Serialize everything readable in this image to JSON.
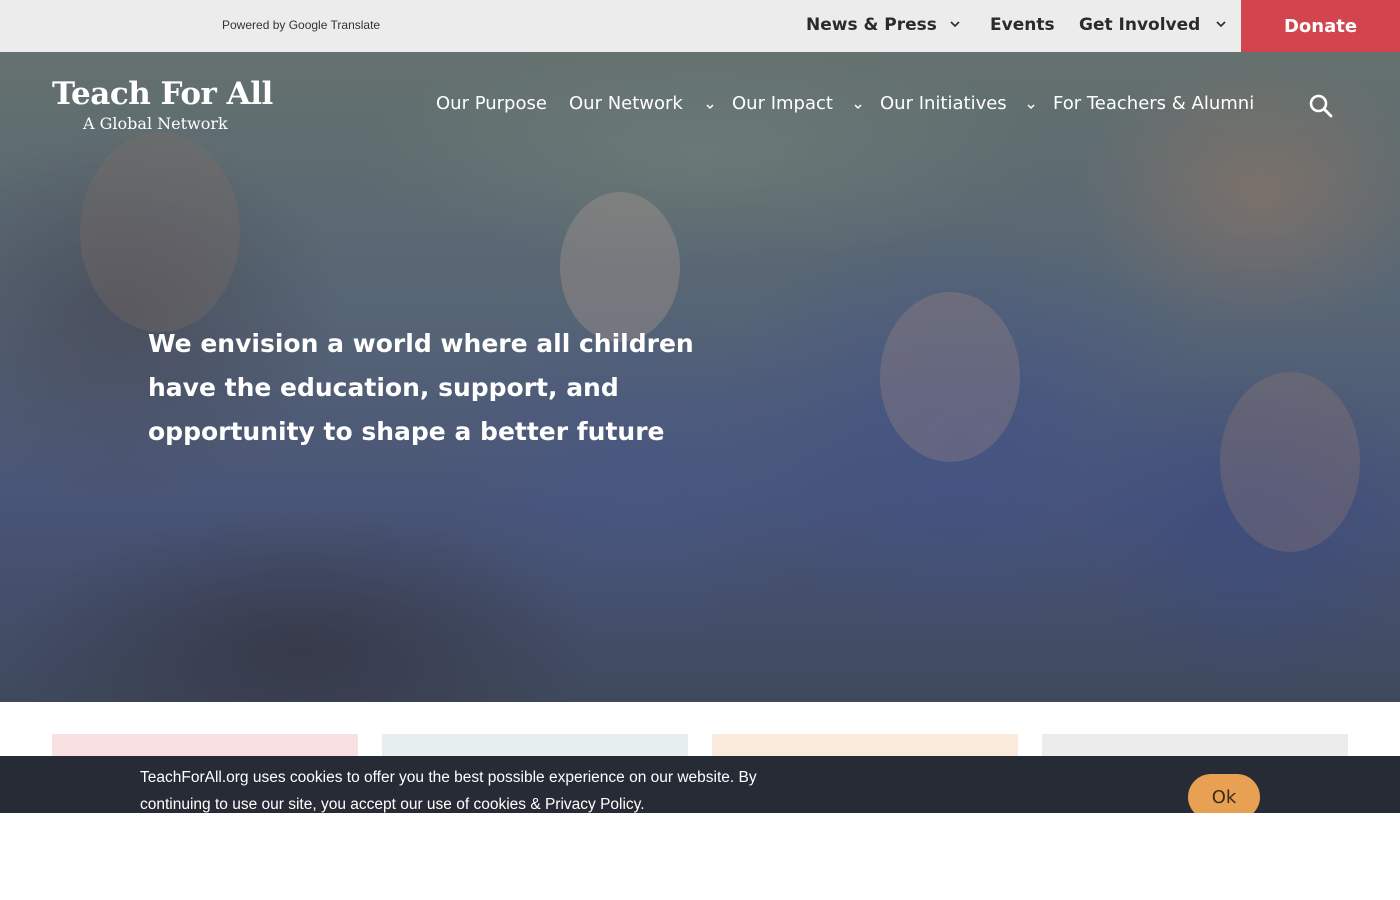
{
  "topbar": {
    "powered_by": "Powered by Google Translate",
    "items": [
      {
        "label": "News & Press",
        "has_dropdown": true
      },
      {
        "label": "Events",
        "has_dropdown": false
      },
      {
        "label": "Get Involved",
        "has_dropdown": true
      }
    ],
    "donate_label": "Donate",
    "donate_color": "#d3454e"
  },
  "logo": {
    "main": "Teach For All",
    "sub": "A Global Network"
  },
  "nav": {
    "items": [
      {
        "label": "Our Purpose",
        "has_dropdown": false
      },
      {
        "label": "Our Network",
        "has_dropdown": true
      },
      {
        "label": "Our Impact",
        "has_dropdown": true
      },
      {
        "label": "Our Initiatives",
        "has_dropdown": true
      },
      {
        "label": "For Teachers & Alumni",
        "has_dropdown": false
      }
    ],
    "search_icon": "search-icon"
  },
  "hero": {
    "headline": "We envision a world where all children have the education, support, and opportunity to shape a better future"
  },
  "cards": {
    "colors": [
      "#f7dfe2",
      "#e6eef0",
      "#faeadb",
      "#ececec"
    ]
  },
  "cookie": {
    "text": "TeachForAll.org uses cookies to offer you the best possible experience on our website. By continuing to use our site, you accept our use of cookies & Privacy Policy.",
    "ok_label": "Ok",
    "ok_color": "#e8a052"
  }
}
